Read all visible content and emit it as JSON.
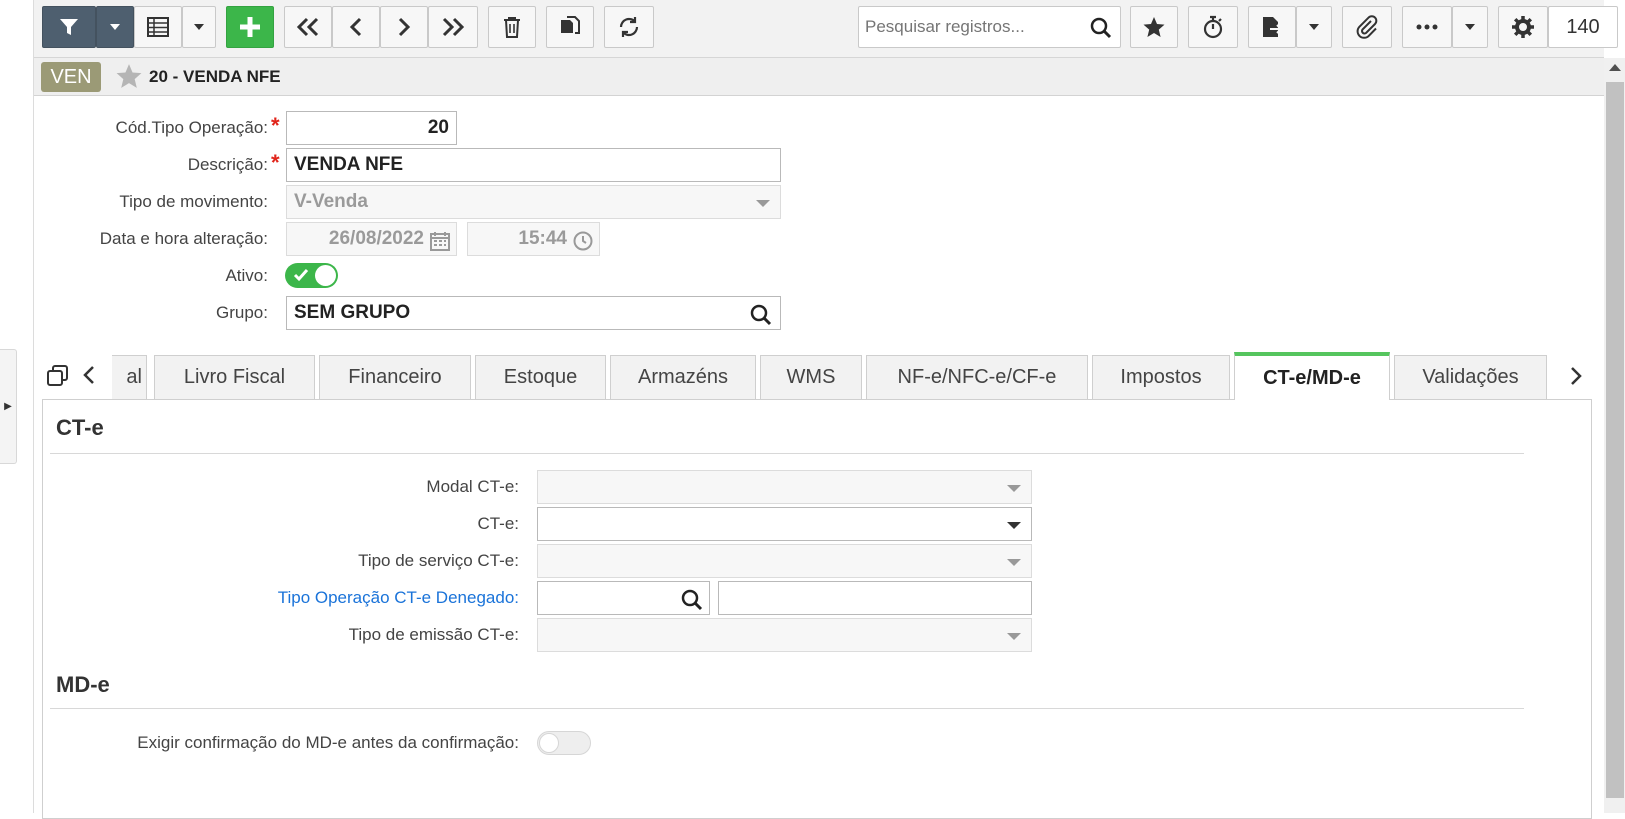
{
  "toolbar": {
    "search_placeholder": "Pesquisar registros...",
    "record_count": "140",
    "icons": [
      "filter-icon",
      "dropdown-icon",
      "grid-icon",
      "add-icon",
      "first-icon",
      "prev-icon",
      "next-icon",
      "last-icon",
      "trash-icon",
      "copy-icon",
      "refresh-icon",
      "star-icon",
      "timer-icon",
      "export-icon",
      "attach-icon",
      "more-icon",
      "gear-icon"
    ]
  },
  "header": {
    "badge": "VEN",
    "title": "20 - VENDA NFE"
  },
  "form": {
    "cod_tipo_label": "Cód.Tipo Operação:",
    "cod_tipo_value": "20",
    "descricao_label": "Descrição:",
    "descricao_value": "VENDA NFE",
    "tipo_mov_label": "Tipo de movimento:",
    "tipo_mov_value": "V-Venda",
    "data_hora_label": "Data e hora alteração:",
    "data_value": "26/08/2022",
    "hora_value": "15:44",
    "ativo_label": "Ativo:",
    "ativo_value": true,
    "grupo_label": "Grupo:",
    "grupo_value": "SEM GRUPO"
  },
  "tabs": [
    {
      "label": "al"
    },
    {
      "label": "Livro Fiscal"
    },
    {
      "label": "Financeiro"
    },
    {
      "label": "Estoque"
    },
    {
      "label": "Armazéns"
    },
    {
      "label": "WMS"
    },
    {
      "label": "NF-e/NFC-e/CF-e"
    },
    {
      "label": "Impostos"
    },
    {
      "label": "CT-e/MD-e",
      "active": true
    },
    {
      "label": "Validações"
    }
  ],
  "cte": {
    "section_title": "CT-e",
    "modal_label": "Modal CT-e:",
    "cte_label": "CT-e:",
    "tipo_servico_label": "Tipo de serviço CT-e:",
    "tipo_op_denegado_label": "Tipo Operação CT-e Denegado:",
    "tipo_emissao_label": "Tipo de emissão CT-e:"
  },
  "mde": {
    "section_title": "MD-e",
    "exigir_label": "Exigir confirmação do MD-e antes da confirmação:",
    "exigir_value": false
  },
  "colors": {
    "accent_green": "#3cb64a",
    "badge": "#9b9a76",
    "toolbar_dark": "#4e5f6f",
    "link_blue": "#1a73d9",
    "required_red": "#e1251b"
  }
}
